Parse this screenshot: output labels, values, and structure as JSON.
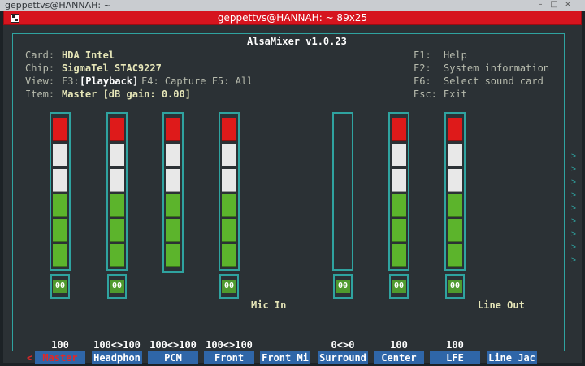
{
  "window": {
    "title": "geppettvs@HANNAH: ~"
  },
  "terminal": {
    "title": "geppettvs@HANNAH: ~ 89x25"
  },
  "mixer": {
    "title": "AlsaMixer v1.0.23",
    "info": {
      "card_key": "Card:",
      "card_val": "HDA Intel",
      "chip_key": "Chip:",
      "chip_val": "SigmaTel STAC9227",
      "view_key": "View:",
      "view_f3": "F3:",
      "view_playback": "[Playback]",
      "view_rest": " F4: Capture  F5: All",
      "item_key": "Item:",
      "item_val": "Master [dB gain: 0.00]"
    },
    "help": [
      {
        "key": "F1:",
        "text": "Help"
      },
      {
        "key": "F2:",
        "text": "System information"
      },
      {
        "key": "F6:",
        "text": "Select sound card"
      },
      {
        "key": "Esc:",
        "text": "Exit"
      }
    ],
    "channels": [
      {
        "name": "Master",
        "volume": "100",
        "switch": "00",
        "level": 1.0,
        "selected": true
      },
      {
        "name": "Headphon",
        "volume": "100<>100",
        "switch": "00",
        "level": 1.0
      },
      {
        "name": "PCM",
        "volume": "100<>100",
        "switch": "",
        "level": 1.0
      },
      {
        "name": "Front",
        "volume": "100<>100",
        "switch": "00",
        "level": 1.0
      },
      {
        "name": "Front Mi",
        "volume": "",
        "switch": "",
        "label_above": "Mic In"
      },
      {
        "name": "Surround",
        "volume": "0<>0",
        "switch": "00",
        "level": 0.0
      },
      {
        "name": "Center",
        "volume": "100",
        "switch": "00",
        "level": 1.0
      },
      {
        "name": "LFE",
        "volume": "100",
        "switch": "00",
        "level": 1.0
      },
      {
        "name": "Line Jac",
        "volume": "",
        "switch": "",
        "label_above": "Line Out"
      }
    ],
    "selected_marker": "<",
    "scroll_indicator": ">",
    "colors": {
      "frame": "#2fa3a0",
      "red": "#de1a1a",
      "white": "#e8e8e8",
      "green": "#5cb42c",
      "name_bg": "#2f66a8",
      "title_bar": "#d6141e"
    }
  }
}
